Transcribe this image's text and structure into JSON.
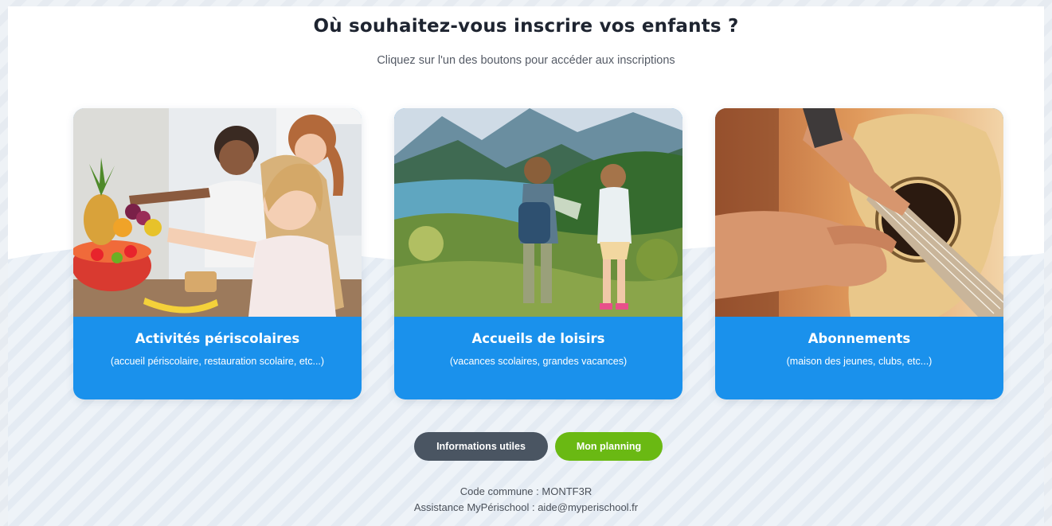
{
  "page": {
    "title": "Où souhaitez-vous inscrire vos enfants ?",
    "subtitle": "Cliquez sur l'un des boutons pour accéder aux inscriptions"
  },
  "cards": [
    {
      "title": "Activités périscolaires",
      "description": "(accueil périscolaire, restauration scolaire, etc...)",
      "image": "children-at-canteen-photo"
    },
    {
      "title": "Accueils de loisirs",
      "description": "(vacances scolaires, grandes vacances)",
      "image": "children-mountain-lake-photo"
    },
    {
      "title": "Abonnements",
      "description": "(maison des jeunes, clubs, etc...)",
      "image": "guitar-lesson-photo"
    }
  ],
  "buttons": {
    "info_label": "Informations utiles",
    "planning_label": "Mon planning"
  },
  "footer": {
    "commune_label": "Code commune : ",
    "commune_code": "MONTF3R",
    "assistance_label": "Assistance MyPérischool : ",
    "assistance_email": "aide@myperischool.fr"
  },
  "colors": {
    "card_blue": "#1a91ec",
    "button_dark": "#4a5562",
    "button_green": "#6ab913",
    "title": "#1e2430"
  }
}
